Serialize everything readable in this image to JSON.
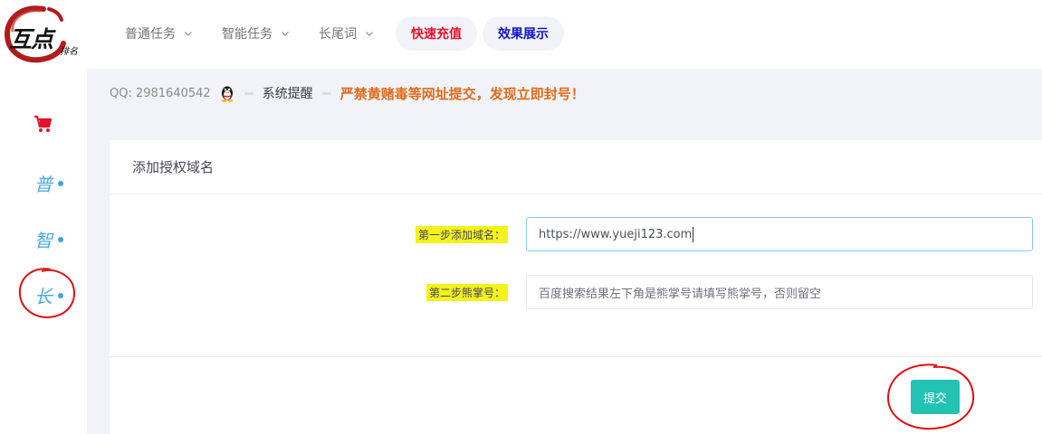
{
  "logo": {
    "main": "互点",
    "sub": "排名"
  },
  "nav": {
    "items": [
      {
        "label": "普通任务"
      },
      {
        "label": "智能任务"
      },
      {
        "label": "长尾词"
      }
    ],
    "recharge_label": "快速充值",
    "showcase_label": "效果展示"
  },
  "sidebar": {
    "items": [
      {
        "label": "普"
      },
      {
        "label": "智"
      },
      {
        "label": "长"
      }
    ]
  },
  "notice": {
    "qq": "QQ: 2981640542",
    "title": "系统提醒",
    "text": "严禁黄赌毒等网址提交，发现立即封号！"
  },
  "form": {
    "title": "添加授权域名",
    "step1_label": "第一步添加域名：",
    "step1_value": "https://www.yueji123.com",
    "step2_label": "第二步熊掌号：",
    "step2_placeholder": "百度搜索结果左下角是熊掌号请填写熊掌号，否则留空",
    "submit_label": "提交"
  },
  "colors": {
    "accent_red": "#e4112a",
    "accent_blue": "#1414c8",
    "submit": "#22c3b3",
    "warning_text": "#e06b1a",
    "highlight": "#f3f21a",
    "sidebar_dot": "#3aa3e6"
  },
  "icons": [
    "cart-icon",
    "qq-penguin-icon",
    "chevron-down-icon"
  ]
}
